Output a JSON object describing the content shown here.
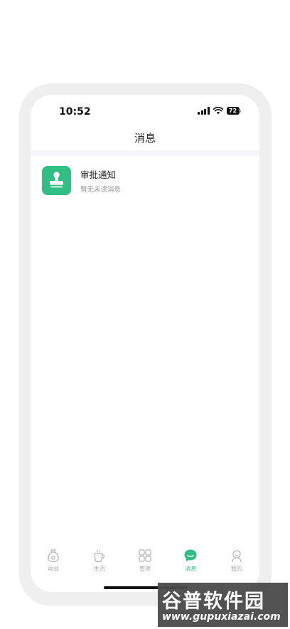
{
  "status_bar": {
    "time": "10:52",
    "battery": "72"
  },
  "nav": {
    "title": "消息"
  },
  "messages": [
    {
      "title": "审批通知",
      "subtitle": "暂无未读消息",
      "icon": "stamp-icon"
    }
  ],
  "tabbar": {
    "active": "消息",
    "items": [
      {
        "label": "收益",
        "icon": "money-bag-icon"
      },
      {
        "label": "生活",
        "icon": "cup-icon"
      },
      {
        "label": "管理",
        "icon": "grid-icon"
      },
      {
        "label": "消息",
        "icon": "chat-bubble-icon"
      },
      {
        "label": "我的",
        "icon": "person-icon"
      }
    ]
  },
  "watermark": {
    "title": "谷普软件园",
    "url": "www.gupuxiazai.com"
  },
  "colors": {
    "accent": "#2fbe84",
    "frame": "#efefef",
    "inactive": "#aaaaaa"
  }
}
